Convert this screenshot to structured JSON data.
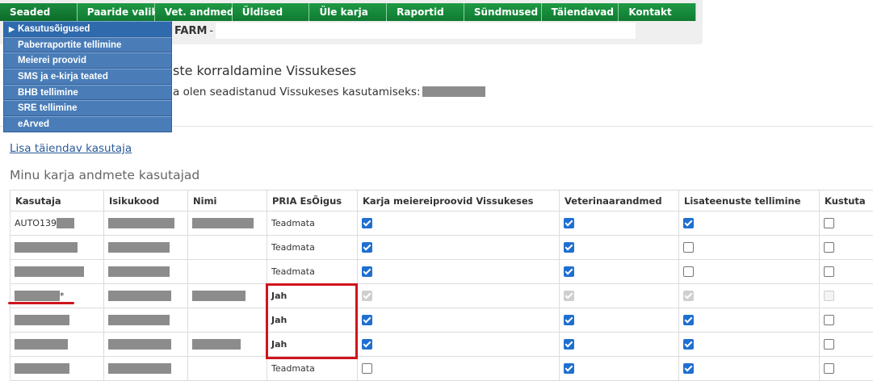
{
  "nav": {
    "items": [
      "Seaded",
      "Paaride valik",
      "Vet. andmed",
      "Üldised",
      "Üle karja",
      "Raportid",
      "Sündmused",
      "Täiendavad",
      "Kontakt"
    ]
  },
  "dropdown": {
    "items": [
      "Kasutusõigused",
      "Paberraportite tellimine",
      "Meierei proovid",
      "SMS ja e-kirja teated",
      "BHB tellimine",
      "SRE tellimine",
      "eArved"
    ]
  },
  "farm": {
    "label": "FARM",
    "separator": "-"
  },
  "page": {
    "title": "ste korraldamine Vissukeses",
    "subtitle": "a olen seadistanud Vissukeses kasutamiseks:",
    "add_user_link": "Lisa täiendav kasutaja",
    "section_title": "Minu karja andmete kasutajad"
  },
  "table": {
    "headers": [
      "Kasutaja",
      "Isikukood",
      "Nimi",
      "PRIA EsÕigus",
      "Karja meiereiproovid Vissukeses",
      "Veterinaarandmed",
      "Lisateenuste tellimine",
      "Kustuta"
    ],
    "rows": [
      {
        "kasutaja": "AUTO139",
        "pria": "Teadmata",
        "pria_bold": false,
        "milk": "on",
        "vet": "on",
        "extra": "on",
        "del": "off"
      },
      {
        "kasutaja": "",
        "pria": "Teadmata",
        "pria_bold": false,
        "milk": "on",
        "vet": "on",
        "extra": "off",
        "del": "off"
      },
      {
        "kasutaja": "",
        "pria": "Teadmata",
        "pria_bold": false,
        "milk": "on",
        "vet": "on",
        "extra": "off",
        "del": "off"
      },
      {
        "kasutaja": "*",
        "pria": "Jah",
        "pria_bold": true,
        "milk": "dis",
        "vet": "dis",
        "extra": "dis",
        "del": "disoff"
      },
      {
        "kasutaja": "",
        "pria": "Jah",
        "pria_bold": true,
        "milk": "on",
        "vet": "on",
        "extra": "on",
        "del": "off"
      },
      {
        "kasutaja": "",
        "pria": "Jah",
        "pria_bold": true,
        "milk": "on",
        "vet": "on",
        "extra": "on",
        "del": "off"
      },
      {
        "kasutaja": "",
        "pria": "Teadmata",
        "pria_bold": false,
        "milk": "off",
        "vet": "on",
        "extra": "on",
        "del": "off"
      }
    ]
  },
  "colors": {
    "nav_green": "#1b8c3e",
    "dropdown_blue": "#4a7db8",
    "checkbox_blue": "#1f6fd1",
    "annotation_red": "#d0141c"
  }
}
